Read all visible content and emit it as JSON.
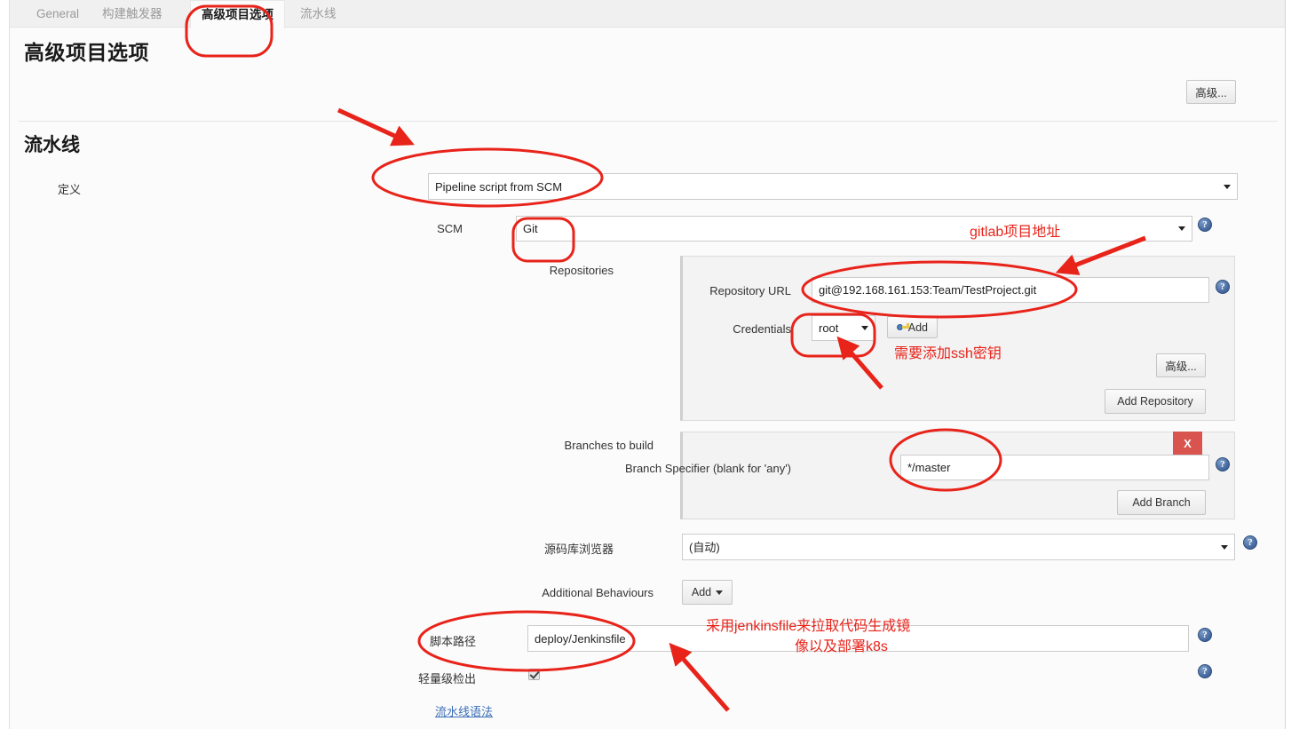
{
  "tabs": [
    {
      "label": "General",
      "active": false
    },
    {
      "label": "构建触发器",
      "active": false
    },
    {
      "label": "高级项目选项",
      "active": true
    },
    {
      "label": "流水线",
      "active": false
    }
  ],
  "page_title": "高级项目选项",
  "advanced_button": "高级...",
  "pipeline": {
    "section_title": "流水线",
    "definition_label": "定义",
    "definition_value": "Pipeline script from SCM",
    "scm_label": "SCM",
    "scm_value": "Git",
    "repositories_label": "Repositories",
    "repository_url_label": "Repository URL",
    "repository_url_value": "git@192.168.161.153:Team/TestProject.git",
    "credentials_label": "Credentials",
    "credentials_value": "root",
    "credentials_add_button": "Add",
    "credentials_add_icon": "key-icon",
    "repo_advanced_button": "高级...",
    "add_repository_button": "Add Repository",
    "branches_label": "Branches to build",
    "branch_specifier_label": "Branch Specifier (blank for 'any')",
    "branch_specifier_value": "*/master",
    "branch_delete_button": "X",
    "add_branch_button": "Add Branch",
    "browser_label": "源码库浏览器",
    "browser_value": "(自动)",
    "additional_behaviours_label": "Additional Behaviours",
    "additional_behaviours_add_button": "Add",
    "script_path_label": "脚本路径",
    "script_path_value": "deploy/Jenkinsfile",
    "lightweight_label": "轻量级检出",
    "lightweight_checked": true,
    "pipeline_syntax_link": "流水线语法",
    "help_icon": "help-icon"
  },
  "annotations": {
    "color": "#e8231a",
    "notes": [
      {
        "id": "gitlab-address",
        "text": "gitlab项目地址"
      },
      {
        "id": "ssh-key",
        "text": "需要添加ssh密钥"
      },
      {
        "id": "jenkinsfile-line1",
        "text": "采用jenkinsfile来拉取代码生成镜"
      },
      {
        "id": "jenkinsfile-line2",
        "text": "像以及部署k8s"
      }
    ]
  }
}
